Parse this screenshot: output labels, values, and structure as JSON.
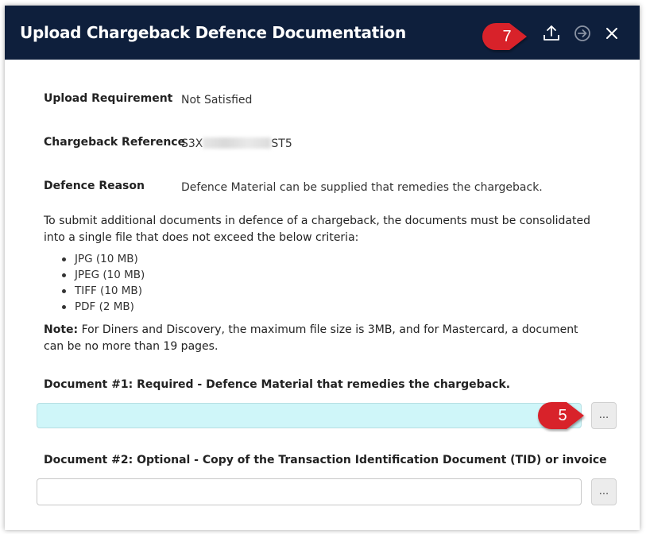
{
  "dialog": {
    "title": "Upload Chargeback Defence Documentation",
    "icons": [
      "upload-icon",
      "arrow-right-circle-icon",
      "close-icon"
    ]
  },
  "callouts": {
    "top": "7",
    "browse": "5"
  },
  "fields": [
    {
      "label": "Upload Requirement",
      "value": "Not Satisfied"
    },
    {
      "label": "Chargeback Reference",
      "value_prefix": "S3X",
      "value_suffix": "ST5"
    },
    {
      "label": "Defence Reason",
      "value": "Defence Material can be supplied that remedies the chargeback."
    }
  ],
  "instructions": "To submit additional documents in defence of a chargeback, the documents must be consolidated into a single file that does not exceed the below criteria:",
  "criteria": [
    "JPG (10 MB)",
    "JPEG (10 MB)",
    "TIFF (10 MB)",
    "PDF (2 MB)"
  ],
  "note": {
    "label": "Note:",
    "text": " For Diners and Discovery, the maximum file size is 3MB, and for Mastercard, a document can be no more than 19 pages."
  },
  "documents": [
    {
      "label": "Document #1: Required - Defence Material that remedies the chargeback.",
      "browse": "..."
    },
    {
      "label": "Document #2: Optional - Copy of the Transaction Identification Document (TID) or invoice",
      "browse": "..."
    }
  ],
  "colors": {
    "titlebar": "#0e1f3c",
    "callout": "#d8202a",
    "active_input": "#cff6f9"
  }
}
